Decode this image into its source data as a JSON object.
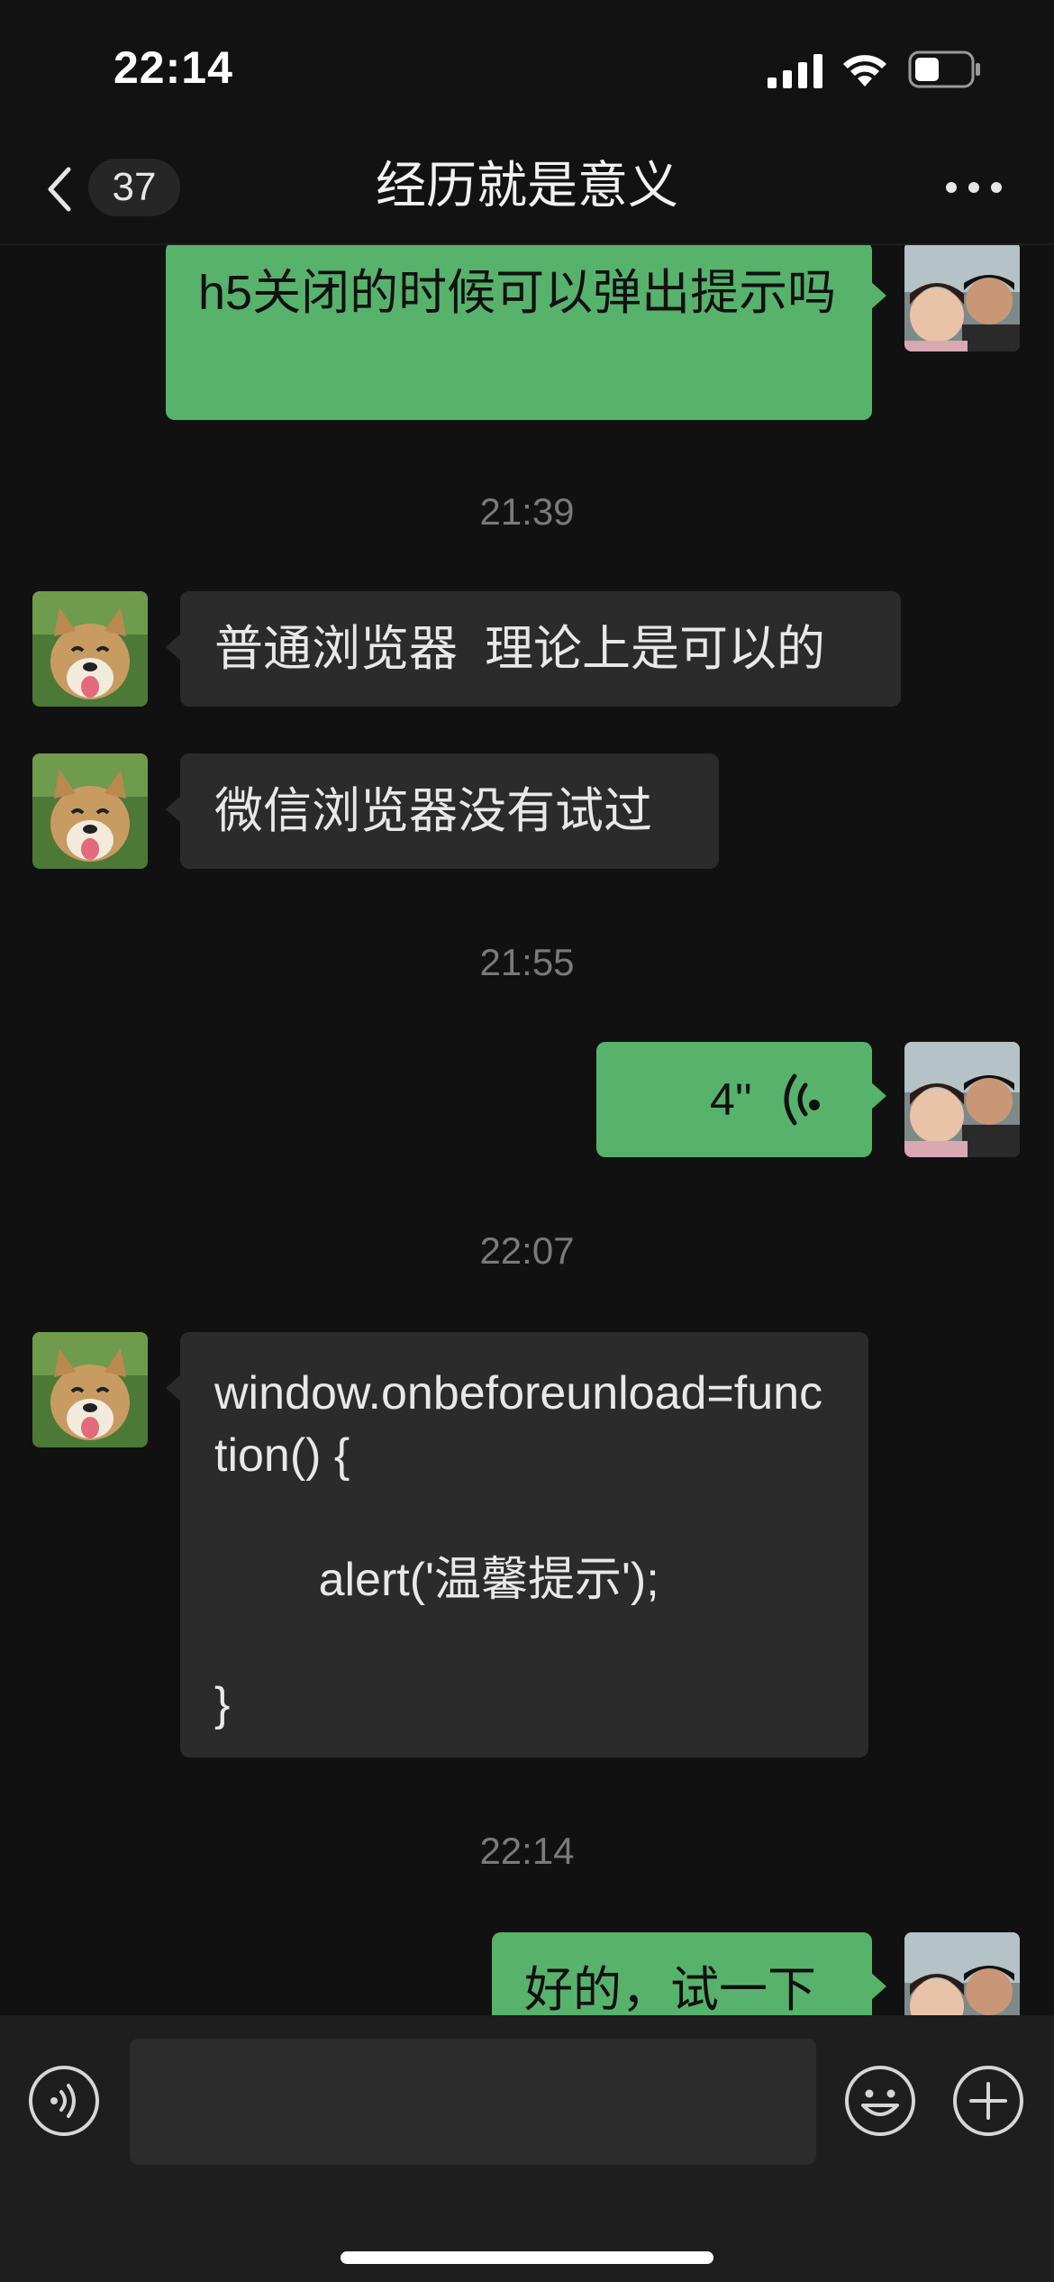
{
  "status_bar": {
    "time": "22:14"
  },
  "nav": {
    "back_count": "37",
    "title": "经历就是意义"
  },
  "messages": [
    {
      "text": "h5关闭的时候可以弹出提示吗"
    },
    {
      "timestamp": "21:39"
    },
    {
      "text": "普通浏览器  理论上是可以的"
    },
    {
      "text": "微信浏览器没有试过"
    },
    {
      "timestamp": "21:55"
    },
    {
      "voice_duration": "4''"
    },
    {
      "timestamp": "22:07"
    },
    {
      "text": "window.onbeforeunload=function() {\n\n        alert('温馨提示');\n\n}"
    },
    {
      "timestamp": "22:14"
    },
    {
      "text": "好的，试一下"
    }
  ],
  "input": {
    "placeholder": ""
  },
  "colors": {
    "sent_bubble": "#57b26b",
    "received_bubble": "#2b2b2b",
    "background": "#111111"
  },
  "icons": [
    "back-chevron-icon",
    "more-icon",
    "voice-wave-icon",
    "voice-mode-icon",
    "emoji-icon",
    "plus-icon",
    "signal-icon",
    "wifi-icon",
    "battery-icon"
  ]
}
